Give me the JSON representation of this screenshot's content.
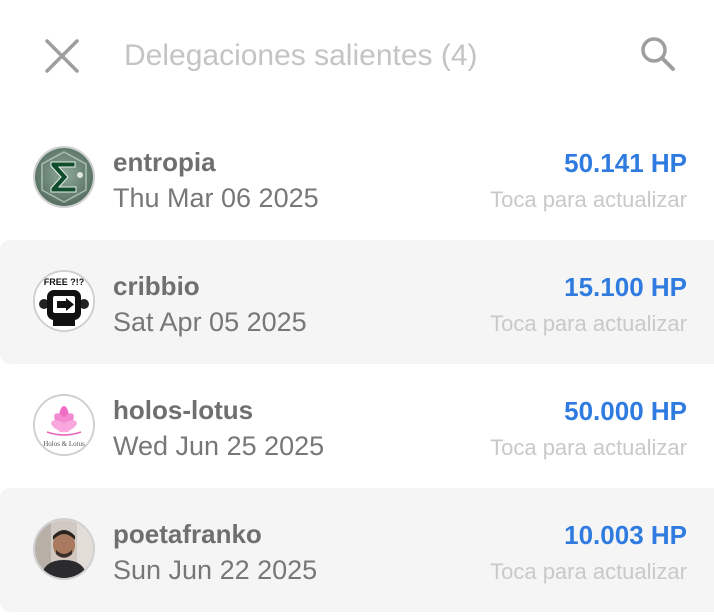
{
  "header": {
    "title": "Delegaciones salientes (4)",
    "close_icon": "close-icon",
    "search_icon": "search-icon"
  },
  "colors": {
    "accent": "#2f7be0",
    "title": "#c4c4c4",
    "username": "#6f6f6f",
    "date": "#777777",
    "hint": "#c9c9c9",
    "alt_row": "#f5f5f5"
  },
  "delegations": [
    {
      "username": "entropia",
      "date": "Thu Mar 06 2025",
      "amount": "50.141 HP",
      "hint": "Toca para actualizar",
      "avatar_icon": "sigma-logo-avatar"
    },
    {
      "username": "cribbio",
      "date": "Sat Apr 05 2025",
      "amount": "15.100 HP",
      "hint": "Toca para actualizar",
      "avatar_icon": "free-robot-logo-avatar",
      "avatar_text": "FREE ?!?"
    },
    {
      "username": "holos-lotus",
      "date": "Wed Jun 25 2025",
      "amount": "50.000 HP",
      "hint": "Toca para actualizar",
      "avatar_icon": "lotus-flower-logo-avatar",
      "avatar_text": "Holos & Lotus"
    },
    {
      "username": "poetafranko",
      "date": "Sun Jun 22 2025",
      "amount": "10.003 HP",
      "hint": "Toca para actualizar",
      "avatar_icon": "person-photo-avatar"
    }
  ]
}
